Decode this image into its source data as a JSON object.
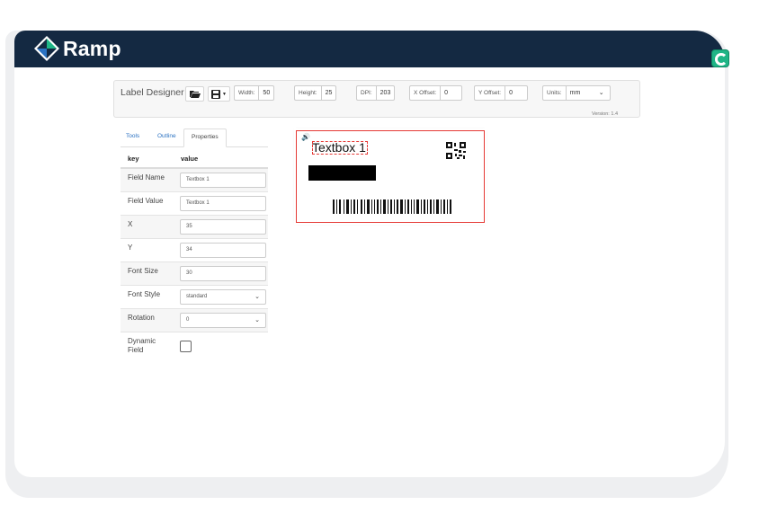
{
  "app": {
    "logo_text": "Ramp",
    "brand_color": "#142942",
    "accent_color": "#1fb586"
  },
  "toolbar": {
    "title": "Label Designer",
    "open_icon": "folder-open-icon",
    "save_icon": "save-icon",
    "width_label": "Width:",
    "width_value": "50",
    "height_label": "Height:",
    "height_value": "25",
    "dpi_label": "DPI:",
    "dpi_value": "203",
    "x_offset_label": "X Offset:",
    "x_offset_value": "0",
    "y_offset_label": "Y Offset:",
    "y_offset_value": "0",
    "units_label": "Units:",
    "units_value": "mm",
    "version": "Version: 1.4"
  },
  "tabs": [
    {
      "label": "Tools"
    },
    {
      "label": "Outline"
    },
    {
      "label": "Properties"
    }
  ],
  "properties": {
    "header_key": "key",
    "header_value": "value",
    "rows": [
      {
        "key": "Field Name",
        "value": "Textbox 1"
      },
      {
        "key": "Field Value",
        "value": "Textbox 1"
      },
      {
        "key": "X",
        "value": "35"
      },
      {
        "key": "Y",
        "value": "34"
      },
      {
        "key": "Font Size",
        "value": "30"
      },
      {
        "key": "Font Style",
        "value": "standard"
      },
      {
        "key": "Rotation",
        "value": "0"
      },
      {
        "key": "Dynamic Field",
        "checked": false
      }
    ]
  },
  "label": {
    "textbox_text": "Textbox 1",
    "speaker_icon": "speaker-icon",
    "qr_icon": "qr-code-icon",
    "selection_color": "#e53935"
  }
}
